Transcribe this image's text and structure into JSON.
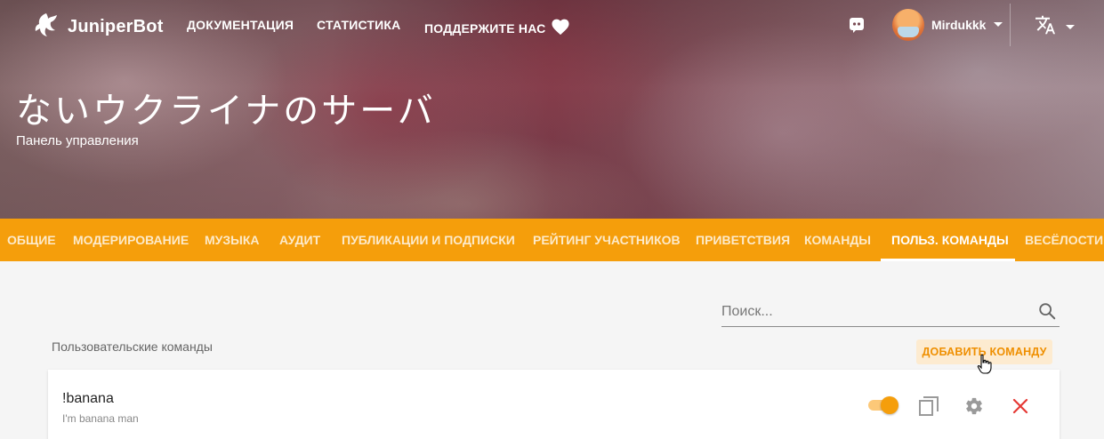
{
  "header": {
    "brand": "JuniperBot",
    "nav": {
      "docs": "ДОКУМЕНТАЦИЯ",
      "stats": "СТАТИСТИКА",
      "support": "ПОДДЕРЖИТЕ НАС"
    },
    "username": "Mirdukkk"
  },
  "hero": {
    "server_name": "ないウクライナのサーバ",
    "subtitle": "Панель управления"
  },
  "tabs": [
    {
      "label": "ОБЩИЕ"
    },
    {
      "label": "МОДЕРИРОВАНИЕ"
    },
    {
      "label": "МУЗЫКА"
    },
    {
      "label": "АУДИТ"
    },
    {
      "label": "ПУБЛИКАЦИИ И ПОДПИСКИ"
    },
    {
      "label": "РЕЙТИНГ УЧАСТНИКОВ"
    },
    {
      "label": "ПРИВЕТСТВИЯ"
    },
    {
      "label": "КОМАНДЫ"
    },
    {
      "label": "ПОЛЬЗ. КОМАНДЫ",
      "active": true
    },
    {
      "label": "ВЕСЁЛОСТИ"
    }
  ],
  "search": {
    "placeholder": "Поиск...",
    "value": ""
  },
  "section": {
    "title": "Пользовательские команды",
    "add_button": "ДОБАВИТЬ КОМАНДУ"
  },
  "commands": [
    {
      "name": "!banana",
      "description": "I'm banana man",
      "enabled": true
    }
  ],
  "colors": {
    "accent": "#f59e0b",
    "delete": "#e53935"
  },
  "icons": [
    "juniper-logo-icon",
    "heart-icon",
    "discord-icon",
    "chevron-down-icon",
    "translate-icon",
    "search-icon",
    "copy-icon",
    "gear-icon",
    "close-icon",
    "hand-cursor-icon"
  ]
}
